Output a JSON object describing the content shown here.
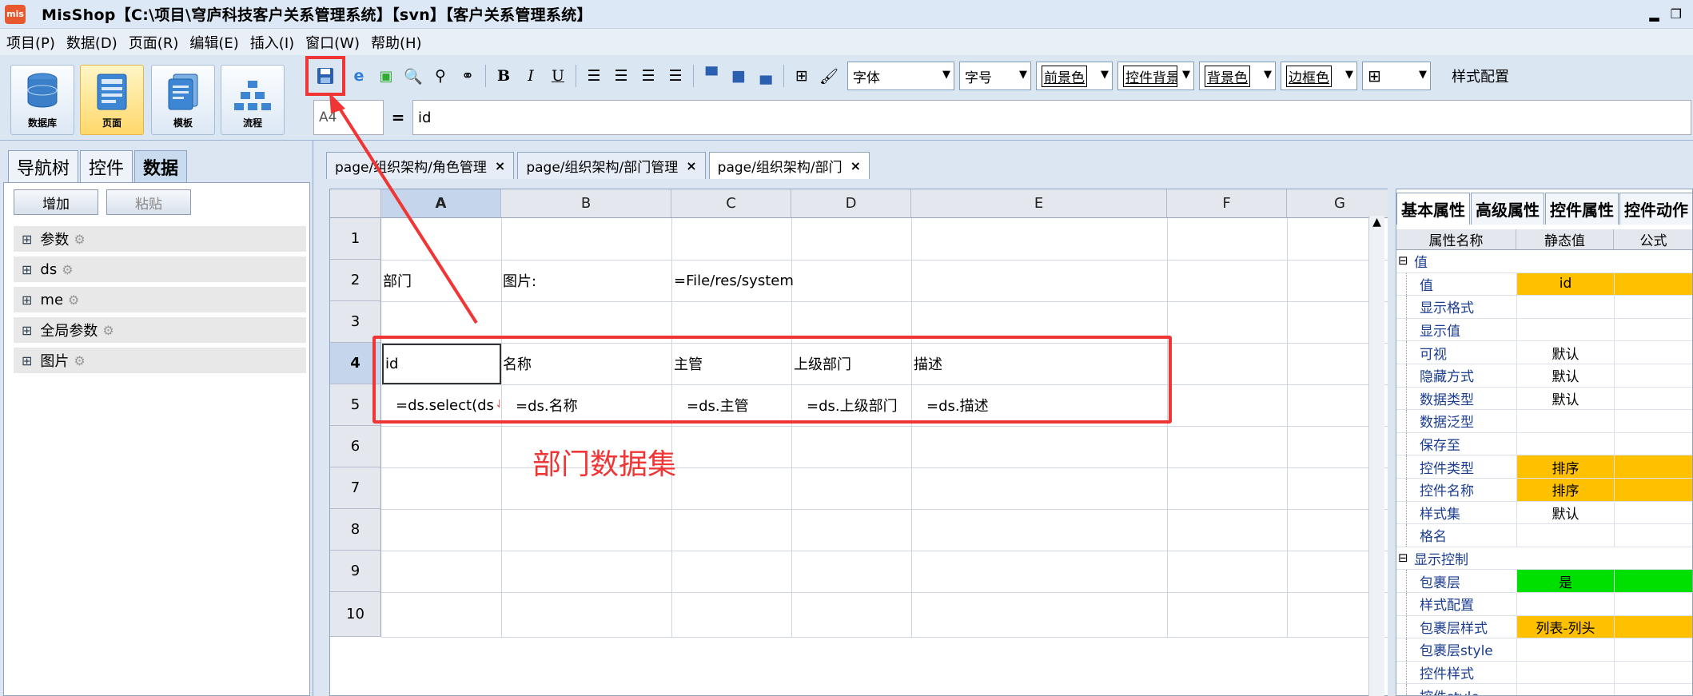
{
  "window": {
    "app_icon_text": "mis",
    "title": "MisShop【C:\\项目\\穹庐科技客户关系管理系统】【svn】【客户关系管理系统】",
    "min_label": "▂",
    "restore_label": "❐"
  },
  "menu": [
    "项目(P)",
    "数据(D)",
    "页面(R)",
    "编辑(E)",
    "插入(I)",
    "窗口(W)",
    "帮助(H)"
  ],
  "modes": [
    {
      "label": "数据库",
      "icon": "database-icon"
    },
    {
      "label": "页面",
      "icon": "page-icon"
    },
    {
      "label": "模板",
      "icon": "template-icon"
    },
    {
      "label": "流程",
      "icon": "flow-icon"
    }
  ],
  "toolbar": {
    "icons": [
      "save-icon",
      "ie-icon",
      "preview-icon",
      "print-preview-icon",
      "find-icon",
      "replace-icon"
    ],
    "bold": "B",
    "italic": "I",
    "underline": "U",
    "font": "字体",
    "size": "字号",
    "fg": "前景色",
    "ctrl_bg": "控件背景",
    "bg": "背景色",
    "border": "边框色",
    "style_config": "样式配置"
  },
  "formula": {
    "cell_ref": "A4",
    "eq": "=",
    "value": "id"
  },
  "left": {
    "tabs": [
      "导航树",
      "控件",
      "数据"
    ],
    "active_tab": "数据",
    "add_label": "增加",
    "paste_label": "粘贴",
    "tree": [
      "参数",
      "ds",
      "me",
      "全局参数",
      "图片"
    ]
  },
  "doc_tabs": [
    {
      "label": "page/组织架构/角色管理",
      "close": "×"
    },
    {
      "label": "page/组织架构/部门管理",
      "close": "×"
    },
    {
      "label": "page/组织架构/部门",
      "close": "×"
    }
  ],
  "sheet": {
    "columns": [
      "A",
      "B",
      "C",
      "D",
      "E",
      "F",
      "G"
    ],
    "selected_column": "A",
    "rows": [
      "1",
      "2",
      "3",
      "4",
      "5",
      "6",
      "7",
      "8",
      "9",
      "10"
    ],
    "selected_row": "4",
    "cells": {
      "r2": [
        "部门",
        "图片:",
        "=File/res/system",
        "",
        ""
      ],
      "r4": [
        "id",
        "名称",
        "主管",
        "上级部门",
        "描述"
      ],
      "r5": [
        "=ds.select(ds.",
        "=ds.名称",
        "=ds.主管",
        "=ds.上级部门",
        "=ds.描述"
      ]
    }
  },
  "annotation": {
    "text": "部门数据集"
  },
  "right": {
    "tabs": [
      "基本属性",
      "高级属性",
      "控件属性",
      "控件动作"
    ],
    "headers": [
      "属性名称",
      "静态值",
      "公式"
    ],
    "rows": [
      {
        "group": true,
        "name": "值"
      },
      {
        "name": "值",
        "value": "id",
        "color": "#ffc000"
      },
      {
        "name": "显示格式",
        "value": ""
      },
      {
        "name": "显示值",
        "value": ""
      },
      {
        "name": "可视",
        "value": "默认"
      },
      {
        "name": "隐藏方式",
        "value": "默认"
      },
      {
        "name": "数据类型",
        "value": "默认"
      },
      {
        "name": "数据泛型",
        "value": ""
      },
      {
        "name": "保存至",
        "value": ""
      },
      {
        "name": "控件类型",
        "value": "排序",
        "color": "#ffc000"
      },
      {
        "name": "控件名称",
        "value": "排序",
        "color": "#ffc000"
      },
      {
        "name": "样式集",
        "value": "默认"
      },
      {
        "name": "格名",
        "value": ""
      },
      {
        "group": true,
        "name": "显示控制"
      },
      {
        "name": "包裹层",
        "value": "是",
        "color": "#00e000"
      },
      {
        "name": "样式配置",
        "value": ""
      },
      {
        "name": "包裹层样式",
        "value": "列表-列头",
        "color": "#ffc000"
      },
      {
        "name": "包裹层style",
        "value": ""
      },
      {
        "name": "控件样式",
        "value": ""
      },
      {
        "name": "控件style",
        "value": ""
      }
    ]
  },
  "colors": {
    "highlight_red": "#f03535",
    "orange": "#ffc000",
    "green": "#00e000",
    "accent": "#c9dcef"
  }
}
